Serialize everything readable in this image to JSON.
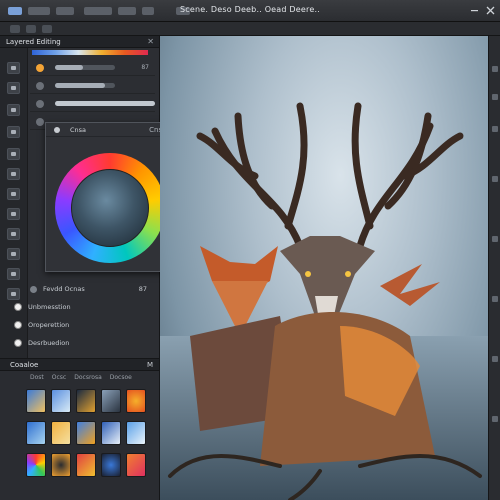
{
  "window": {
    "title": "Scene. Deso Deeb.. Oead Deere.."
  },
  "left_panel": {
    "title": "Layered Editing",
    "rows": [
      {
        "value": "87"
      }
    ],
    "layers": [
      {
        "label": "Fevdd Ocnas",
        "value": "87"
      },
      {
        "label": "Unbmesstion"
      },
      {
        "label": "Oroperettion"
      },
      {
        "label": "Desrbuedion"
      }
    ]
  },
  "color_popup": {
    "title": "Cnsa",
    "label": "Cnsr"
  },
  "gallery": {
    "title": "Coaaloe",
    "mark": "M",
    "tabs": [
      "Dost",
      "Ocsc",
      "Docsrosa",
      "Docsoe"
    ]
  },
  "colors": {
    "accent": "#f4a436",
    "panel": "#2c2e33",
    "titlebar": "#2b2d31"
  },
  "icons": {
    "close": "close-icon",
    "eye": "eye-icon",
    "pin": "pin-icon"
  }
}
